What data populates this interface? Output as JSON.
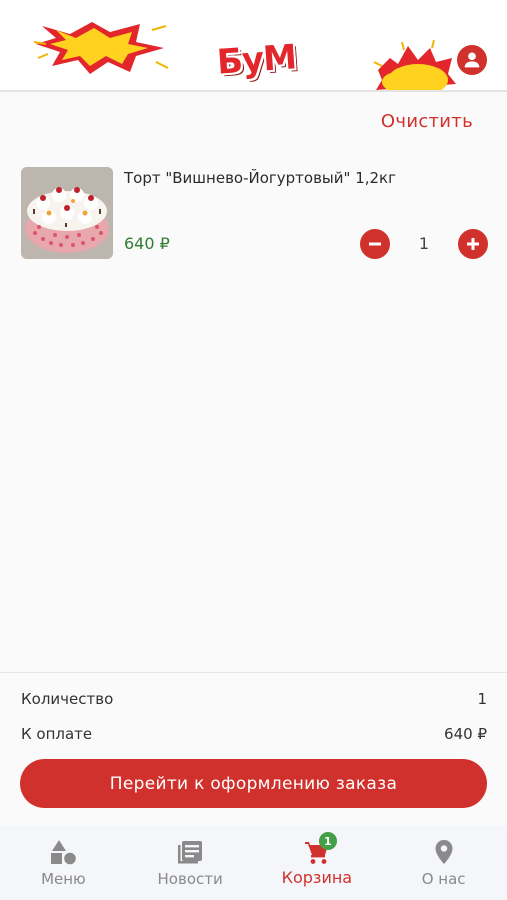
{
  "header": {
    "logo_text": "БуМ"
  },
  "actions": {
    "clear_label": "Очистить"
  },
  "cart": {
    "items": [
      {
        "title": "Торт \"Вишнево-Йогуртовый\" 1,2кг",
        "price": "640 ₽",
        "quantity": "1"
      }
    ]
  },
  "summary": {
    "quantity_label": "Количество",
    "quantity_value": "1",
    "pay_label": "К оплате",
    "pay_value": "640 ₽",
    "checkout_label": "Перейти к оформлению заказа"
  },
  "nav": {
    "items": [
      {
        "label": "Меню",
        "icon": "menu-shapes-icon",
        "active": false
      },
      {
        "label": "Новости",
        "icon": "news-icon",
        "active": false
      },
      {
        "label": "Корзина",
        "icon": "cart-icon",
        "active": true,
        "badge": "1"
      },
      {
        "label": "О нас",
        "icon": "location-pin-icon",
        "active": false
      }
    ]
  },
  "colors": {
    "accent": "#d0312d",
    "price": "#2e7d32",
    "badge": "#43a047",
    "nav_inactive": "#8a8a8a"
  }
}
